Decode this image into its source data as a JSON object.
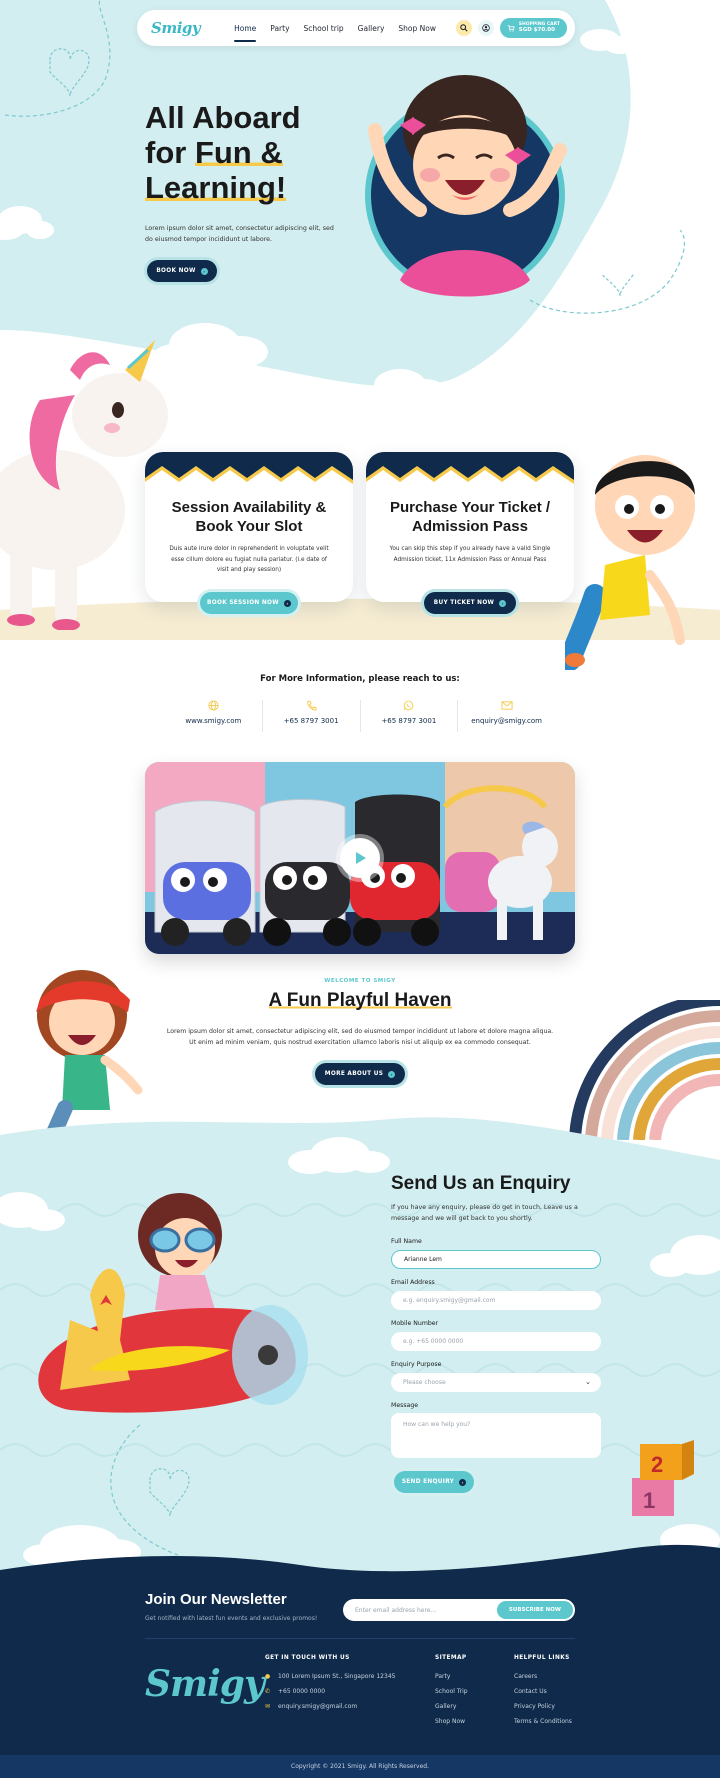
{
  "colors": {
    "navy": "#0f2a4a",
    "teal": "#5cc8ce",
    "sky": "#d3eef0",
    "yellow": "#f6c94a"
  },
  "nav": {
    "logo": "Smigy",
    "links": [
      "Home",
      "Party",
      "School trip",
      "Gallery",
      "Shop Now"
    ],
    "active": "Home",
    "icons": [
      "search-icon",
      "user-icon",
      "cart-icon"
    ],
    "cart_label": "SHOPPING CART",
    "cart_amount": "SGD $70.00"
  },
  "hero": {
    "title_line1": "All Aboard",
    "title_line2_a": "for ",
    "title_line2_b": "Fun &",
    "title_line3": "Learning!",
    "desc": "Lorem ipsum dolor sit amet, consectetur adipiscing elit, sed do eiusmod tempor incididunt ut labore.",
    "button": "BOOK NOW"
  },
  "cards": [
    {
      "title": "Session Availability & Book Your Slot",
      "text": "Duis aute irure dolor in reprehenderit in voluptate velit esse cillum dolore eu fugiat nulla pariatur. (i.e date of visit and play session)",
      "button": "BOOK SESSION NOW"
    },
    {
      "title": "Purchase Your Ticket / Admission Pass",
      "text": "You can skip this step if you already have a valid Single Admission ticket, 11x Admission Pass or Annual Pass",
      "button": "BUY TICKET NOW"
    }
  ],
  "info": {
    "title": "For More Information, please reach to us:",
    "items": [
      {
        "icon": "globe-icon",
        "value": "www.smigy.com"
      },
      {
        "icon": "phone-icon",
        "value": "+65 8797 3001"
      },
      {
        "icon": "whatsapp-icon",
        "value": "+65 8797 3001"
      },
      {
        "icon": "mail-icon",
        "value": "enquiry@smigy.com"
      }
    ]
  },
  "about": {
    "kicker": "WELCOME TO SMIGY",
    "title": "A Fun Playful Haven",
    "text": "Lorem ipsum dolor sit amet, consectetur adipiscing elit, sed do eiusmod tempor incididunt ut labore et dolore magna aliqua. Ut enim ad minim veniam, quis nostrud exercitation ullamco laboris nisi ut aliquip ex ea commodo consequat.",
    "button": "MORE ABOUT US"
  },
  "enquiry": {
    "title": "Send Us an Enquiry",
    "desc": "If you have any enquiry, please do get in touch. Leave us a message and we will get back to you shortly.",
    "fields": [
      {
        "label": "Full Name",
        "value": "Arianne Lem",
        "placeholder": ""
      },
      {
        "label": "Email Address",
        "value": "",
        "placeholder": "e.g. enquiry.smigy@gmail.com"
      },
      {
        "label": "Mobile Number",
        "value": "",
        "placeholder": "e.g. +65 0000 0000"
      },
      {
        "label": "Enquiry Purpose",
        "value": "",
        "placeholder": "Please choose"
      },
      {
        "label": "Message",
        "value": "",
        "placeholder": "How can we help you?"
      }
    ],
    "button": "SEND ENQUIRY"
  },
  "newsletter": {
    "title": "Join Our Newsletter",
    "sub": "Get notified with latest fun events and exclusive promos!",
    "placeholder": "Enter email address here...",
    "button": "SUBSCRIBE NOW"
  },
  "footer": {
    "logo": "Smigy",
    "contact_head": "GET IN TOUCH WITH US",
    "contact": [
      {
        "icon": "pin-icon",
        "text": "100 Lorem Ipsum St., Singapore 12345"
      },
      {
        "icon": "phone-icon",
        "text": "+65 0000 0000"
      },
      {
        "icon": "mail-icon",
        "text": "enquiry.smigy@gmail.com"
      }
    ],
    "sitemap_head": "SITEMAP",
    "sitemap": [
      "Party",
      "School Trip",
      "Gallery",
      "Shop Now"
    ],
    "helpful_head": "HELPFUL LINKS",
    "helpful": [
      "Careers",
      "Contact Us",
      "Privacy Policy",
      "Terms & Conditions"
    ],
    "copyright": "Copyright © 2021 Smigy. All Rights Reserved."
  }
}
